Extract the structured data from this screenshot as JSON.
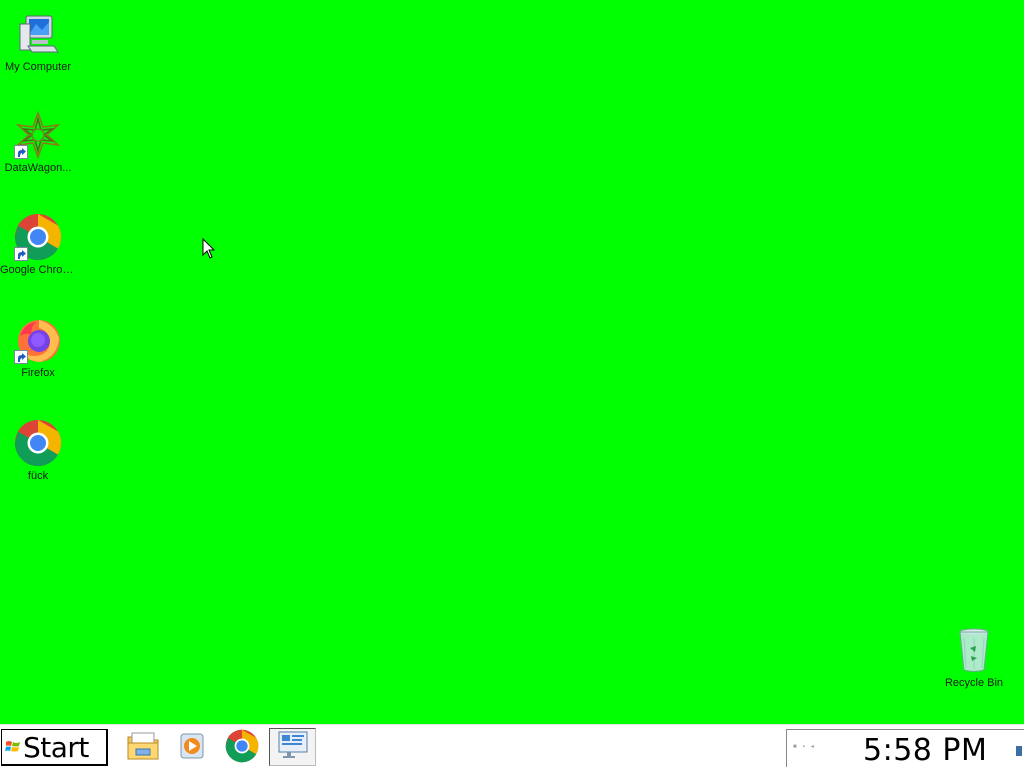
{
  "desktop": {
    "background_color": "#00ff00",
    "icons": [
      {
        "label": "My Computer",
        "icon": "my-computer-icon"
      },
      {
        "label": "DataWagon...",
        "icon": "datawagon-icon",
        "shortcut": true
      },
      {
        "label": "Google Chrome",
        "icon": "chrome-icon",
        "shortcut": true
      },
      {
        "label": "Firefox",
        "icon": "firefox-icon",
        "shortcut": true
      },
      {
        "label": "fück",
        "icon": "chrome-icon"
      },
      {
        "label": "Recycle Bin",
        "icon": "recycle-bin-icon"
      }
    ]
  },
  "taskbar": {
    "start_label": "Start",
    "quick_launch": [
      {
        "icon": "file-explorer-icon"
      },
      {
        "icon": "media-player-icon"
      },
      {
        "icon": "chrome-icon"
      }
    ],
    "active_task_icon": "control-panel-icon",
    "clock": "5:58 PM"
  }
}
